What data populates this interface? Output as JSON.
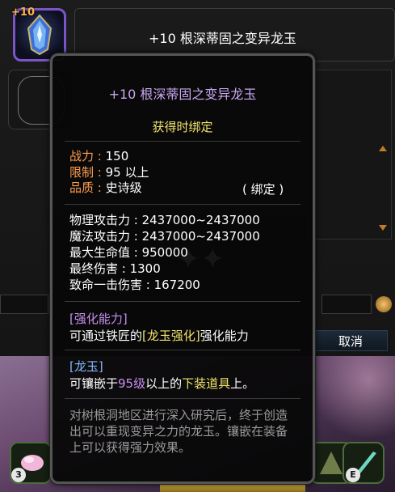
{
  "item": {
    "enhance_level": "+10",
    "name": "+10 根深蒂固之变异龙玉"
  },
  "buttons": {
    "cancel": "取消"
  },
  "hotkeys": [
    "3",
    "E"
  ],
  "tooltip": {
    "title": "+10 根深蒂固之变异龙玉",
    "bind_on_obtain": "获得时绑定",
    "power_label": "战力 :",
    "power_value": "150",
    "limit_label": "限制 :",
    "limit_value": "95 以上",
    "quality_label": "品质 :",
    "quality_value": "史诗级",
    "bound_tag": "( 绑定 )",
    "stats": [
      "物理攻击力 : 2437000~2437000",
      "魔法攻击力 : 2437000~2437000",
      "最大生命值 :  950000",
      "最终伤害 : 1300",
      "致命一击伤害 : 167200"
    ],
    "enhance_section": {
      "header": "[强化能力]",
      "text_pre": "可通过铁匠的",
      "text_link": "[龙玉强化]",
      "text_post": "强化能力"
    },
    "dragon_jade_section": {
      "header": "[龙玉]",
      "text_pre": "可镶嵌于",
      "text_level": "95级",
      "text_mid": "以上的",
      "text_gear": "下装道具",
      "text_post": "上。"
    },
    "flavor_text": "对树根洞地区进行深入研究后，终于创造出可以重现变异之力的龙玉。镶嵌在装备上可以获得强力效果。"
  },
  "colors": {
    "title_purple": "#c9a7f2",
    "bind_yellow": "#f0e36a",
    "label_orange": "#ff9d50",
    "section_purple": "#c890f0",
    "section_blue": "#86b6ff",
    "flavor_gray": "#9a9a9a"
  }
}
